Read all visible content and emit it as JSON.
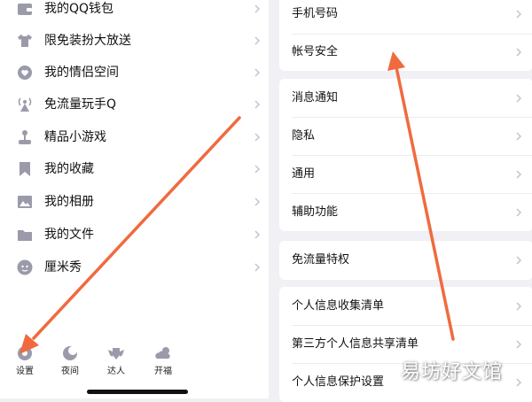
{
  "left_menu": [
    {
      "label": "我的QQ钱包",
      "icon": "wallet-icon"
    },
    {
      "label": "限免装扮大放送",
      "icon": "shirt-icon"
    },
    {
      "label": "我的情侣空间",
      "icon": "heart-icon"
    },
    {
      "label": "免流量玩手Q",
      "icon": "antenna-icon"
    },
    {
      "label": "精品小游戏",
      "icon": "joystick-icon"
    },
    {
      "label": "我的收藏",
      "icon": "bookmark-icon"
    },
    {
      "label": "我的相册",
      "icon": "image-icon"
    },
    {
      "label": "我的文件",
      "icon": "folder-icon"
    },
    {
      "label": "厘米秀",
      "icon": "avatar-face-icon"
    }
  ],
  "bottom_bar": [
    {
      "label": "设置",
      "icon": "settings-gear-icon"
    },
    {
      "label": "夜间",
      "icon": "moon-icon"
    },
    {
      "label": "达人",
      "icon": "badge-wings-icon"
    },
    {
      "label": "开福",
      "icon": "cloud-sun-icon"
    }
  ],
  "settings_groups": [
    {
      "items": [
        "手机号码",
        "帐号安全"
      ]
    },
    {
      "items": [
        "消息通知",
        "隐私",
        "通用",
        "辅助功能"
      ]
    },
    {
      "items": [
        "免流量特权"
      ]
    },
    {
      "items": [
        "个人信息收集清单",
        "第三方个人信息共享清单",
        "个人信息保护设置"
      ]
    }
  ],
  "watermark": "易坊好文馆",
  "colors": {
    "icon_gray": "#9a9aaa",
    "arrow": "#ef6b3f",
    "chevron": "#c4c4cc",
    "panel_bg": "#f0f0f5"
  }
}
